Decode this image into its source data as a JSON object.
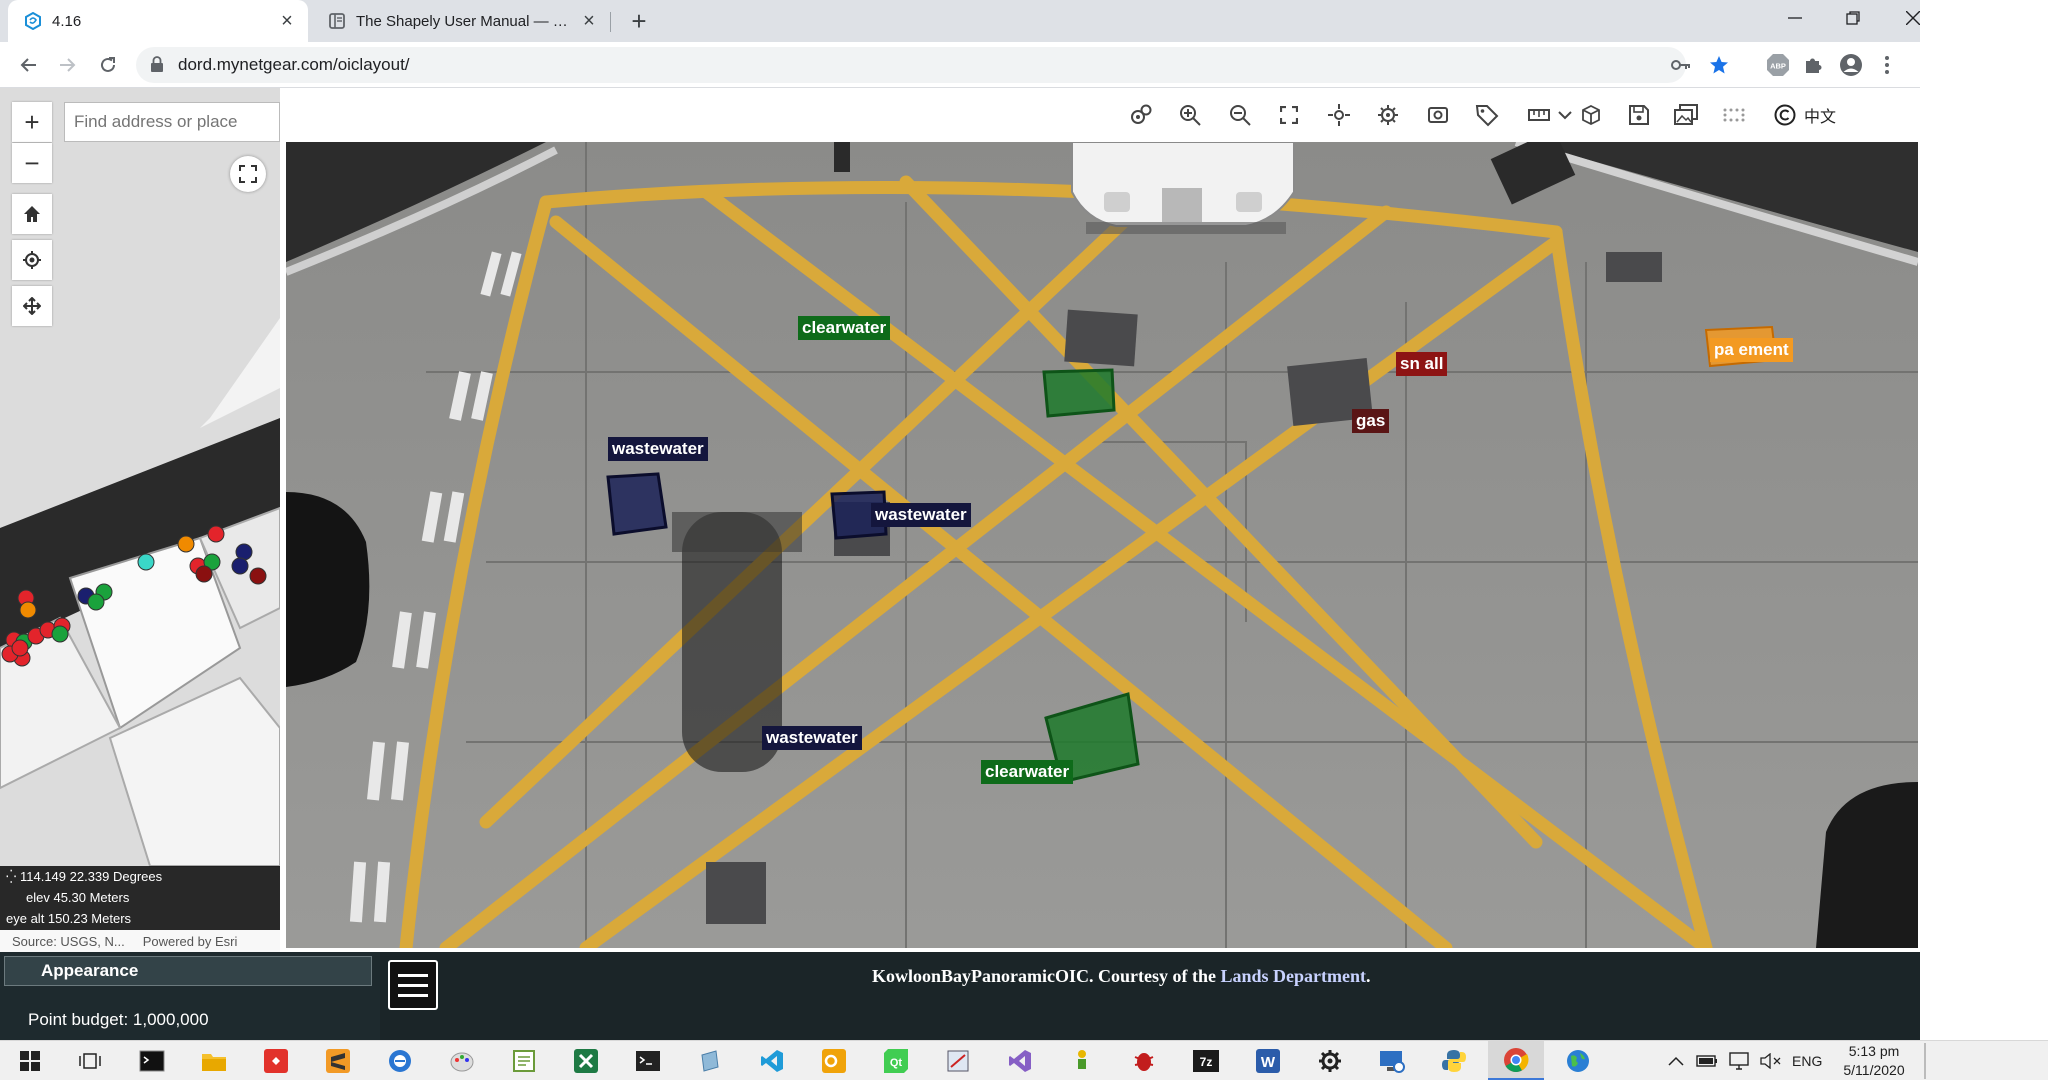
{
  "browser": {
    "tabs": [
      {
        "title": "4.16",
        "active": true
      },
      {
        "title": "The Shapely User Manual — Sha",
        "active": false
      }
    ],
    "url": "dord.mynetgear.com/oiclayout/",
    "ext_abp_label": "ABP",
    "window_controls": [
      "minimize",
      "restore",
      "close"
    ]
  },
  "map": {
    "search_placeholder": "Find address or place",
    "zoom_in_label": "+",
    "zoom_out_label": "−",
    "coord_line": "114.149 22.339 Degrees",
    "elev_line": "elev 45.30 Meters",
    "eye_alt_line": "eye alt 150.23 Meters",
    "source_text": "Source: USGS, N...",
    "powered_text": "Powered by Esri",
    "marker_colors": [
      "#e3242b",
      "#1aa23c",
      "#f08a00",
      "#3ad7c8",
      "#1a1f6e",
      "#8a1010"
    ]
  },
  "viewer": {
    "tools": [
      "settings-cogs-icon",
      "zoom-in-icon",
      "zoom-out-icon",
      "fit-icon",
      "move-icon",
      "gear-icon",
      "camera-icon",
      "tag-icon",
      "measure-icon",
      "dropdown-icon",
      "cube-icon",
      "save-icon",
      "images-icon",
      "dots-icon",
      "copyright-icon"
    ],
    "lang_label": "中文"
  },
  "annotations": [
    {
      "label": "clearwater",
      "class": "cw"
    },
    {
      "label": "sn all",
      "class": "sn"
    },
    {
      "label": "gas",
      "class": "gas"
    },
    {
      "label": "pa ement",
      "class": "pv"
    },
    {
      "label": "wastewater",
      "class": "ww"
    },
    {
      "label": "wastewater",
      "class": "ww"
    },
    {
      "label": "wastewater",
      "class": "ww"
    },
    {
      "label": "clearwater",
      "class": "cw"
    }
  ],
  "bottom": {
    "appearance_label": "Appearance",
    "point_budget": "Point budget: 1,000,000",
    "credit_prefix": "KowloonBayPanoramicOIC. Courtesy of the ",
    "credit_dept": "Lands Department",
    "credit_suffix": "."
  },
  "taskbar": {
    "apps": [
      "start-icon",
      "task-view-icon",
      "cmd-icon",
      "file-explorer-icon",
      "anydesk-icon",
      "sublime-icon",
      "edge-icon",
      "paint-icon",
      "notepad-icon",
      "excel-icon",
      "terminal-icon",
      "notebook-icon",
      "vscode-icon",
      "outlook-icon",
      "qt-icon",
      "screenshot-icon",
      "visual-studio-icon",
      "figure-icon",
      "bug-icon",
      "7zip-icon",
      "word-icon",
      "settings-icon",
      "remote-icon",
      "python-icon",
      "chrome-icon",
      "globe-icon"
    ],
    "lang": "ENG",
    "time": "5:13 pm",
    "date": "5/11/2020"
  }
}
